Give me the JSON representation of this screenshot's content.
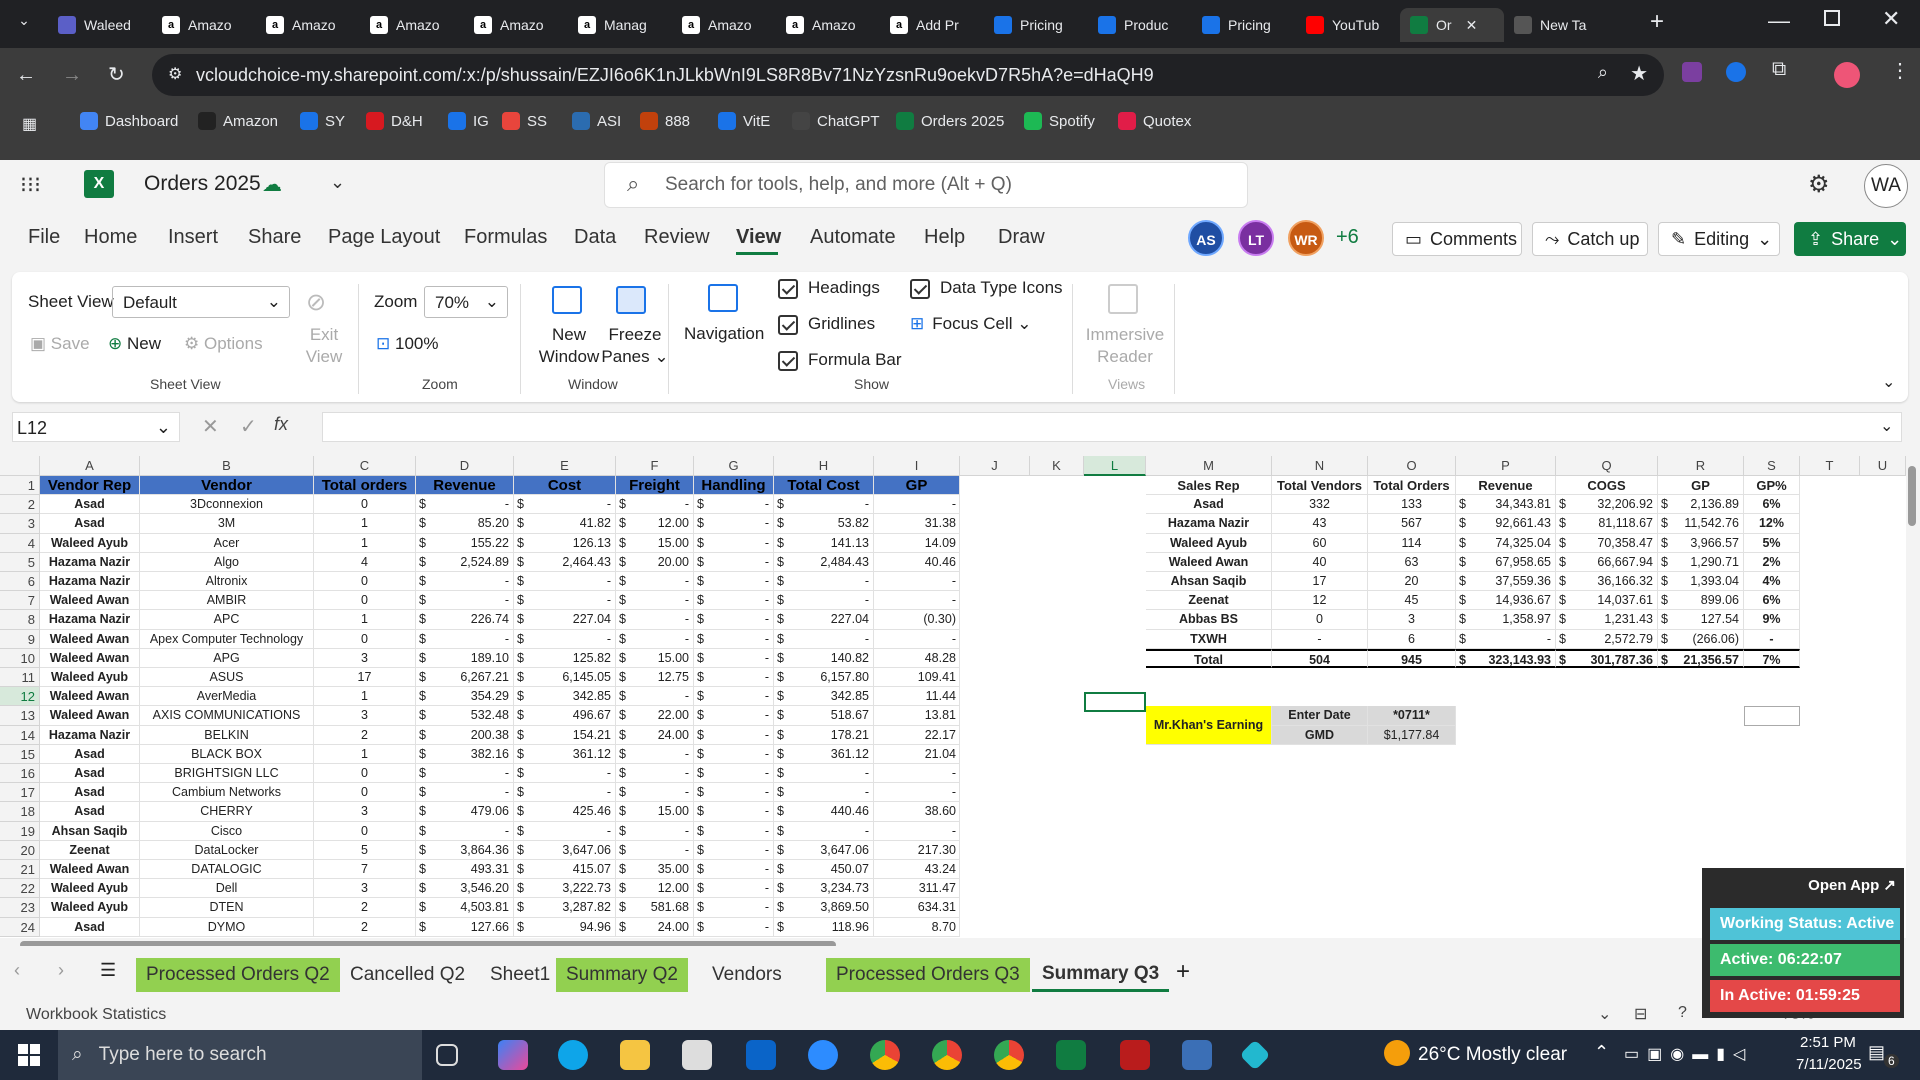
{
  "browser": {
    "tabs": [
      {
        "label": "Waleed",
        "icon": "teams-icon"
      },
      {
        "label": "Amazo",
        "icon": "amazon-icon"
      },
      {
        "label": "Amazo",
        "icon": "amazon-icon"
      },
      {
        "label": "Amazo",
        "icon": "amazon-icon"
      },
      {
        "label": "Amazo",
        "icon": "amazon-icon"
      },
      {
        "label": "Manag",
        "icon": "amazon-icon"
      },
      {
        "label": "Amazo",
        "icon": "amazon-icon"
      },
      {
        "label": "Amazo",
        "icon": "amazon-icon"
      },
      {
        "label": "Add Pr",
        "icon": "amazon-icon"
      },
      {
        "label": "Pricing",
        "icon": "s-icon"
      },
      {
        "label": "Produc",
        "icon": "ec-icon"
      },
      {
        "label": "Pricing",
        "icon": "s-icon"
      },
      {
        "label": "YouTub",
        "icon": "youtube-icon"
      },
      {
        "label": "Or",
        "icon": "excel-icon"
      },
      {
        "label": "New Ta",
        "icon": "chrome-icon"
      }
    ],
    "url": "vcloudchoice-my.sharepoint.com/:x:/p/shussain/EZJI6o6K1nJLkbWnI9LS8R8Bv71NzYzsnRu9oekvD7R5hA?e=dHaQH9",
    "bookmarks": [
      "Dashboard",
      "Amazon",
      "SY",
      "D&H",
      "IG",
      "SS",
      "ASI",
      "888",
      "VitE",
      "ChatGPT",
      "Orders 2025",
      "Spotify",
      "Quotex"
    ]
  },
  "app": {
    "title": "Orders 2025",
    "search_placeholder": "Search for tools, help, and more (Alt + Q)",
    "avatar": "WA",
    "menu": [
      "File",
      "Home",
      "Insert",
      "Share",
      "Page Layout",
      "Formulas",
      "Data",
      "Review",
      "View",
      "Automate",
      "Help",
      "Draw"
    ],
    "active_menu": "View",
    "collaborators": [
      "AS",
      "LT",
      "WR"
    ],
    "more_collab": "+6",
    "comments": "Comments",
    "catchup": "Catch up",
    "editing": "Editing",
    "share": "Share"
  },
  "ribbon": {
    "sheet_view_label": "Sheet View",
    "sheet_view_value": "Default",
    "save": "Save",
    "new": "New",
    "options": "Options",
    "exit_view": "Exit View",
    "group_sheet_view": "Sheet View",
    "zoom_label": "Zoom",
    "zoom_value": "70%",
    "zoom_100": "100%",
    "group_zoom": "Zoom",
    "new_window": "New Window",
    "freeze_panes": "Freeze Panes",
    "group_window": "Window",
    "navigation": "Navigation",
    "headings": "Headings",
    "gridlines": "Gridlines",
    "formula_bar": "Formula Bar",
    "data_type_icons": "Data Type Icons",
    "focus_cell": "Focus Cell",
    "group_show": "Show",
    "immersive_reader": "Immersive Reader",
    "group_views": "Views"
  },
  "formula": {
    "namebox": "L12",
    "fx": "fx"
  },
  "columns": [
    "A",
    "B",
    "C",
    "D",
    "E",
    "F",
    "G",
    "H",
    "I",
    "J",
    "K",
    "L",
    "M",
    "N",
    "O",
    "P",
    "Q",
    "R",
    "S",
    "T",
    "U"
  ],
  "main_headers": [
    "Vendor Rep",
    "Vendor",
    "Total orders",
    "Revenue",
    "Cost",
    "Freight",
    "Handling",
    "Total Cost",
    "GP"
  ],
  "rows": [
    [
      "Asad",
      "3Dconnexion",
      "0",
      "-",
      "-",
      "-",
      "-",
      "-",
      "-"
    ],
    [
      "Asad",
      "3M",
      "1",
      "85.20",
      "41.82",
      "12.00",
      "-",
      "53.82",
      "31.38"
    ],
    [
      "Waleed Ayub",
      "Acer",
      "1",
      "155.22",
      "126.13",
      "15.00",
      "-",
      "141.13",
      "14.09"
    ],
    [
      "Hazama Nazir",
      "Algo",
      "4",
      "2,524.89",
      "2,464.43",
      "20.00",
      "-",
      "2,484.43",
      "40.46"
    ],
    [
      "Hazama Nazir",
      "Altronix",
      "0",
      "-",
      "-",
      "-",
      "-",
      "-",
      "-"
    ],
    [
      "Waleed Awan",
      "AMBIR",
      "0",
      "-",
      "-",
      "-",
      "-",
      "-",
      "-"
    ],
    [
      "Hazama Nazir",
      "APC",
      "1",
      "226.74",
      "227.04",
      "-",
      "-",
      "227.04",
      "(0.30)"
    ],
    [
      "Waleed Awan",
      "Apex Computer Technology",
      "0",
      "-",
      "-",
      "-",
      "-",
      "-",
      "-"
    ],
    [
      "Waleed Awan",
      "APG",
      "3",
      "189.10",
      "125.82",
      "15.00",
      "-",
      "140.82",
      "48.28"
    ],
    [
      "Waleed Ayub",
      "ASUS",
      "17",
      "6,267.21",
      "6,145.05",
      "12.75",
      "-",
      "6,157.80",
      "109.41"
    ],
    [
      "Waleed Awan",
      "AverMedia",
      "1",
      "354.29",
      "342.85",
      "-",
      "-",
      "342.85",
      "11.44"
    ],
    [
      "Waleed Awan",
      "AXIS COMMUNICATIONS",
      "3",
      "532.48",
      "496.67",
      "22.00",
      "-",
      "518.67",
      "13.81"
    ],
    [
      "Hazama Nazir",
      "BELKIN",
      "2",
      "200.38",
      "154.21",
      "24.00",
      "-",
      "178.21",
      "22.17"
    ],
    [
      "Asad",
      "BLACK BOX",
      "1",
      "382.16",
      "361.12",
      "-",
      "-",
      "361.12",
      "21.04"
    ],
    [
      "Asad",
      "BRIGHTSIGN LLC",
      "0",
      "-",
      "-",
      "-",
      "-",
      "-",
      "-"
    ],
    [
      "Asad",
      "Cambium Networks",
      "0",
      "-",
      "-",
      "-",
      "-",
      "-",
      "-"
    ],
    [
      "Asad",
      "CHERRY",
      "3",
      "479.06",
      "425.46",
      "15.00",
      "-",
      "440.46",
      "38.60"
    ],
    [
      "Ahsan Saqib",
      "Cisco",
      "0",
      "-",
      "-",
      "-",
      "-",
      "-",
      "-"
    ],
    [
      "Zeenat",
      "DataLocker",
      "5",
      "3,864.36",
      "3,647.06",
      "-",
      "-",
      "3,647.06",
      "217.30"
    ],
    [
      "Waleed Awan",
      "DATALOGIC",
      "7",
      "493.31",
      "415.07",
      "35.00",
      "-",
      "450.07",
      "43.24"
    ],
    [
      "Waleed Ayub",
      "Dell",
      "3",
      "3,546.20",
      "3,222.73",
      "12.00",
      "-",
      "3,234.73",
      "311.47"
    ],
    [
      "Waleed Ayub",
      "DTEN",
      "2",
      "4,503.81",
      "3,287.82",
      "581.68",
      "-",
      "3,869.50",
      "634.31"
    ],
    [
      "Asad",
      "DYMO",
      "2",
      "127.66",
      "94.96",
      "24.00",
      "-",
      "118.96",
      "8.70"
    ]
  ],
  "summary_headers": [
    "Sales Rep",
    "Total Vendors",
    "Total Orders",
    "Revenue",
    "COGS",
    "GP",
    "GP%"
  ],
  "summary_rows": [
    [
      "Asad",
      "332",
      "133",
      "34,343.81",
      "32,206.92",
      "2,136.89",
      "6%"
    ],
    [
      "Hazama Nazir",
      "43",
      "567",
      "92,661.43",
      "81,118.67",
      "11,542.76",
      "12%"
    ],
    [
      "Waleed Ayub",
      "60",
      "114",
      "74,325.04",
      "70,358.47",
      "3,966.57",
      "5%"
    ],
    [
      "Waleed Awan",
      "40",
      "63",
      "67,958.65",
      "66,667.94",
      "1,290.71",
      "2%"
    ],
    [
      "Ahsan Saqib",
      "17",
      "20",
      "37,559.36",
      "36,166.32",
      "1,393.04",
      "4%"
    ],
    [
      "Zeenat",
      "12",
      "45",
      "14,936.67",
      "14,037.61",
      "899.06",
      "6%"
    ],
    [
      "Abbas BS",
      "0",
      "3",
      "1,358.97",
      "1,231.43",
      "127.54",
      "9%"
    ],
    [
      "TXWH",
      "-",
      "6",
      "-",
      "2,572.79",
      "(266.06)",
      "-"
    ],
    [
      "Total",
      "504",
      "945",
      "323,143.93",
      "301,787.36",
      "21,356.57",
      "7%"
    ]
  ],
  "earning": {
    "label": "Mr.Khan's Earning",
    "enter_date": "Enter Date",
    "date_value": "*0711*",
    "gmd": "GMD",
    "amount": "$1,177.84"
  },
  "currency": "$",
  "sheets": [
    {
      "name": "Processed Orders Q2",
      "color": "#92d050"
    },
    {
      "name": "Cancelled Q2",
      "color": ""
    },
    {
      "name": "Sheet1",
      "color": ""
    },
    {
      "name": "Summary Q2",
      "color": "#92d050"
    },
    {
      "name": "Vendors",
      "color": ""
    },
    {
      "name": "Processed Orders Q3",
      "color": "#92d050"
    },
    {
      "name": "Summary Q3",
      "color": "",
      "active": true
    }
  ],
  "status": {
    "left": "Workbook Statistics",
    "zoom": "70%"
  },
  "overlay": {
    "open_app": "Open App ↗",
    "working": "Working Status: Active",
    "active": "Active: 06:22:07",
    "inactive": "In Active: 01:59:25"
  },
  "taskbar": {
    "search": "Type here to search",
    "weather": "26°C  Mostly clear",
    "time": "2:51 PM",
    "date": "7/11/2025",
    "notif": "6"
  }
}
